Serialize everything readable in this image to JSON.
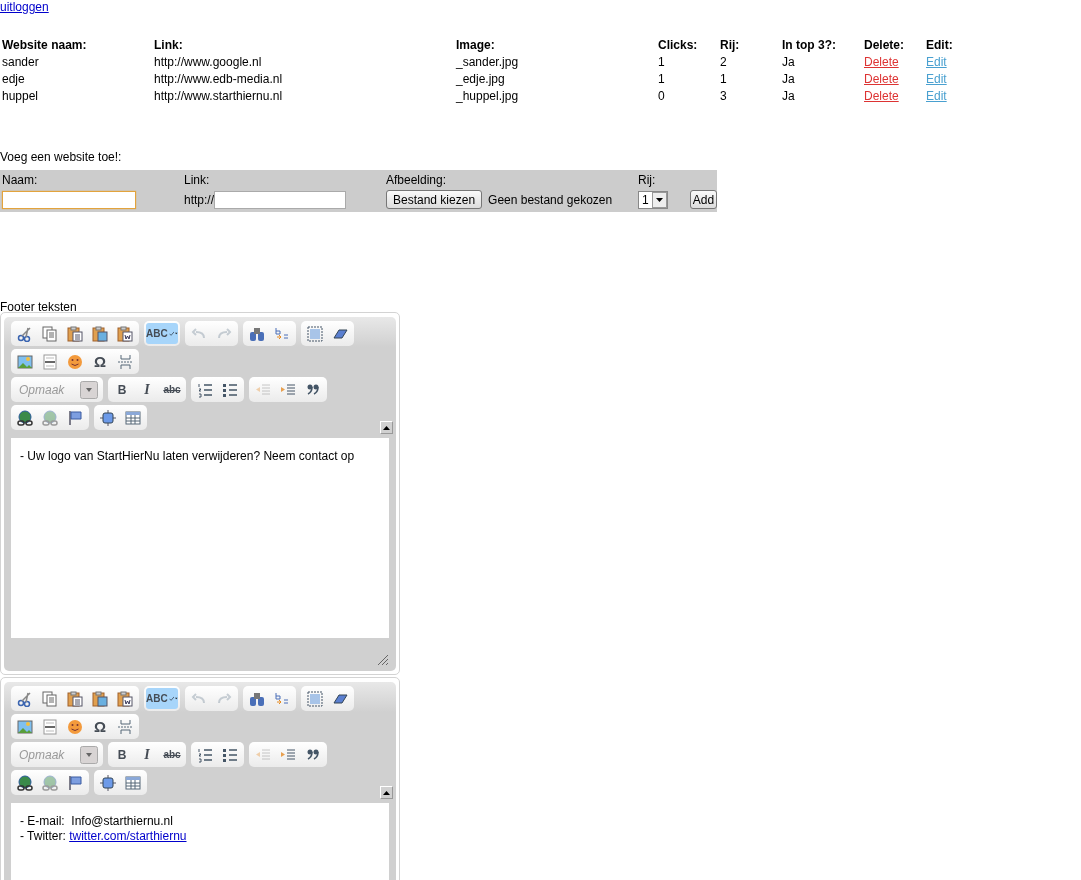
{
  "logout_link": "uitloggen",
  "sites_table": {
    "columns": [
      "Website naam:",
      "Link:",
      "Image:",
      "Clicks:",
      "Rij:",
      "In top 3?:",
      "Delete:",
      "Edit:"
    ],
    "rows": [
      {
        "name": "sander",
        "link": "http://www.google.nl",
        "image": "_sander.jpg",
        "clicks": "1",
        "row": "2",
        "top3": "Ja",
        "delete": "Delete",
        "edit": "Edit"
      },
      {
        "name": "edje",
        "link": "http://www.edb-media.nl",
        "image": "_edje.jpg",
        "clicks": "1",
        "row": "1",
        "top3": "Ja",
        "delete": "Delete",
        "edit": "Edit"
      },
      {
        "name": "huppel",
        "link": "http://www.starthiernu.nl",
        "image": "_huppel.jpg",
        "clicks": "0",
        "row": "3",
        "top3": "Ja",
        "delete": "Delete",
        "edit": "Edit"
      }
    ]
  },
  "add_form": {
    "title": "Voeg een website toe!:",
    "name_label": "Naam:",
    "name_focused": true,
    "link_label": "Link:",
    "link_prefix": "http://",
    "image_label": "Afbeelding:",
    "file_button": "Bestand kiezen",
    "file_status": "Geen bestand gekozen",
    "row_label": "Rij:",
    "row_value": "1",
    "add_button": "Add"
  },
  "footer_title": "Footer teksten",
  "editors": [
    {
      "toolbar": [
        [
          [
            {
              "kind": "cut",
              "disabled": false
            },
            {
              "kind": "copy",
              "disabled": false
            },
            {
              "kind": "paste",
              "disabled": false
            },
            {
              "kind": "paste-text",
              "disabled": false
            },
            {
              "kind": "paste-word",
              "disabled": false
            }
          ],
          [
            {
              "kind": "spellcheck",
              "label": "ABC",
              "active": true,
              "disabled": false
            }
          ],
          [
            {
              "kind": "undo",
              "disabled": true
            },
            {
              "kind": "redo",
              "disabled": true
            }
          ],
          [
            {
              "kind": "find",
              "disabled": false
            },
            {
              "kind": "replace",
              "disabled": false
            }
          ],
          [
            {
              "kind": "select-all",
              "disabled": false
            },
            {
              "kind": "eraser",
              "disabled": false
            }
          ]
        ],
        [
          [
            {
              "kind": "image",
              "disabled": false
            },
            {
              "kind": "rule",
              "disabled": false
            },
            {
              "kind": "smiley",
              "disabled": false
            },
            {
              "kind": "char",
              "label": "Ω",
              "disabled": false
            },
            {
              "kind": "page-break",
              "disabled": false
            }
          ]
        ],
        [
          [
            {
              "kind": "combo",
              "placeholder": "Opmaak"
            }
          ],
          [
            {
              "kind": "bold",
              "label": "B",
              "disabled": false
            },
            {
              "kind": "italic",
              "label": "I",
              "disabled": false
            },
            {
              "kind": "strike",
              "label": "abc",
              "disabled": false
            }
          ],
          [
            {
              "kind": "numbered-list",
              "disabled": false
            },
            {
              "kind": "bullet-list",
              "disabled": false
            }
          ],
          [
            {
              "kind": "outdent",
              "disabled": true
            },
            {
              "kind": "indent",
              "disabled": false
            },
            {
              "kind": "quote",
              "disabled": false
            }
          ]
        ],
        [
          [
            {
              "kind": "link",
              "disabled": false
            },
            {
              "kind": "link",
              "disabled": true
            },
            {
              "kind": "flag",
              "disabled": false
            }
          ],
          [
            {
              "kind": "frame",
              "disabled": false
            },
            {
              "kind": "table",
              "disabled": false
            }
          ]
        ]
      ],
      "lines": [
        {
          "text": "- Uw logo van StartHierNu laten verwijderen? Neem contact op"
        }
      ]
    },
    {
      "toolbar": [
        [
          [
            {
              "kind": "cut",
              "disabled": false
            },
            {
              "kind": "copy",
              "disabled": false
            },
            {
              "kind": "paste",
              "disabled": false
            },
            {
              "kind": "paste-text",
              "disabled": false
            },
            {
              "kind": "paste-word",
              "disabled": false
            }
          ],
          [
            {
              "kind": "spellcheck",
              "label": "ABC",
              "active": true,
              "disabled": false
            }
          ],
          [
            {
              "kind": "undo",
              "disabled": true
            },
            {
              "kind": "redo",
              "disabled": true
            }
          ],
          [
            {
              "kind": "find",
              "disabled": false
            },
            {
              "kind": "replace",
              "disabled": false
            }
          ],
          [
            {
              "kind": "select-all",
              "disabled": false
            },
            {
              "kind": "eraser",
              "disabled": false
            }
          ]
        ],
        [
          [
            {
              "kind": "image",
              "disabled": false
            },
            {
              "kind": "rule",
              "disabled": false
            },
            {
              "kind": "smiley",
              "disabled": false
            },
            {
              "kind": "char",
              "label": "Ω",
              "disabled": false
            },
            {
              "kind": "page-break",
              "disabled": false
            }
          ]
        ],
        [
          [
            {
              "kind": "combo",
              "placeholder": "Opmaak"
            }
          ],
          [
            {
              "kind": "bold",
              "label": "B",
              "disabled": false
            },
            {
              "kind": "italic",
              "label": "I",
              "disabled": false
            },
            {
              "kind": "strike",
              "label": "abc",
              "disabled": false
            }
          ],
          [
            {
              "kind": "numbered-list",
              "disabled": false
            },
            {
              "kind": "bullet-list",
              "disabled": false
            }
          ],
          [
            {
              "kind": "outdent",
              "disabled": true
            },
            {
              "kind": "indent",
              "disabled": false
            },
            {
              "kind": "quote",
              "disabled": false
            }
          ]
        ],
        [
          [
            {
              "kind": "link",
              "disabled": false
            },
            {
              "kind": "link",
              "disabled": true
            },
            {
              "kind": "flag",
              "disabled": false
            }
          ],
          [
            {
              "kind": "frame",
              "disabled": false
            },
            {
              "kind": "table",
              "disabled": false
            }
          ]
        ]
      ],
      "lines": [
        {
          "text": "- E-mail:  Info@starthiernu.nl"
        },
        {
          "text": "- Twitter:",
          "link": "twitter.com/starthiernu"
        }
      ]
    }
  ]
}
